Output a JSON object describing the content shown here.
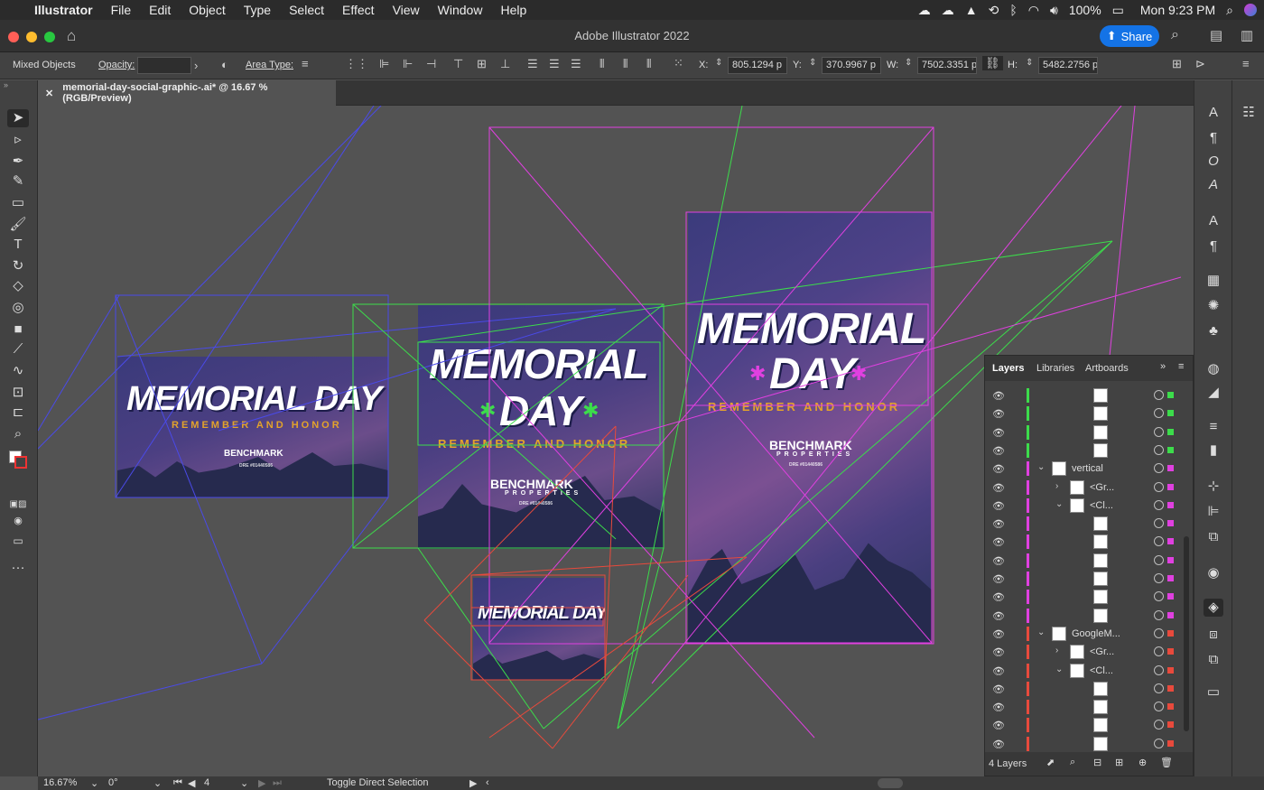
{
  "menubar": {
    "app": "Illustrator",
    "items": [
      "File",
      "Edit",
      "Object",
      "Type",
      "Select",
      "Effect",
      "View",
      "Window",
      "Help"
    ],
    "battery": "100%",
    "clock": "Mon 9:23 PM"
  },
  "titlebar": {
    "title": "Adobe Illustrator 2022",
    "share": "Share"
  },
  "control": {
    "selection": "Mixed Objects",
    "opacity_label": "Opacity:",
    "opacity_value": "",
    "area_type_label": "Area Type:",
    "x_label": "X:",
    "x_value": "805.1294 p",
    "y_label": "Y:",
    "y_value": "370.9967 p",
    "w_label": "W:",
    "w_value": "7502.3351 p",
    "h_label": "H:",
    "h_value": "5482.2756 p"
  },
  "document_tab": {
    "title": "memorial-day-social-graphic-.ai* @ 16.67 % (RGB/Preview)"
  },
  "artwork": {
    "headline_1": "MEMORIAL DAY",
    "headline_a": "MEMORIAL",
    "headline_b": "DAY",
    "tagline": "REMEMBER AND HONOR",
    "logo_name": "BENCHMARK",
    "logo_sub": "PROPERTIES",
    "license": "DRE #01440586"
  },
  "layers_panel": {
    "tabs": [
      "Layers",
      "Libraries",
      "Artboards"
    ],
    "rows": [
      {
        "name": "",
        "color": "#3cdc4b"
      },
      {
        "name": "",
        "color": "#3cdc4b"
      },
      {
        "name": "",
        "color": "#3cdc4b"
      },
      {
        "name": "",
        "color": "#3cdc4b"
      },
      {
        "name": "vertical",
        "color": "#e040e0"
      },
      {
        "name": "<Gr...",
        "color": "#e040e0"
      },
      {
        "name": "<Cl...",
        "color": "#e040e0"
      },
      {
        "name": "",
        "color": "#e040e0"
      },
      {
        "name": "",
        "color": "#e040e0"
      },
      {
        "name": "",
        "color": "#e040e0"
      },
      {
        "name": "",
        "color": "#e040e0"
      },
      {
        "name": "",
        "color": "#e040e0"
      },
      {
        "name": "",
        "color": "#e040e0"
      },
      {
        "name": "GoogleM...",
        "color": "#e84a3c"
      },
      {
        "name": "<Gr...",
        "color": "#e84a3c"
      },
      {
        "name": "<Cl...",
        "color": "#e84a3c"
      },
      {
        "name": "",
        "color": "#e84a3c"
      },
      {
        "name": "",
        "color": "#e84a3c"
      },
      {
        "name": "",
        "color": "#e84a3c"
      },
      {
        "name": "",
        "color": "#e84a3c"
      }
    ],
    "count": "4 Layers"
  },
  "statusbar": {
    "zoom": "16.67%",
    "rotation": "0°",
    "artboard": "4",
    "tool_hint": "Toggle Direct Selection"
  },
  "colors": {
    "layer_green": "#3cdc4b",
    "layer_magenta": "#e040e0",
    "layer_red": "#e84a3c",
    "layer_blue": "#4a4ae8",
    "share_blue": "#1473e6"
  }
}
